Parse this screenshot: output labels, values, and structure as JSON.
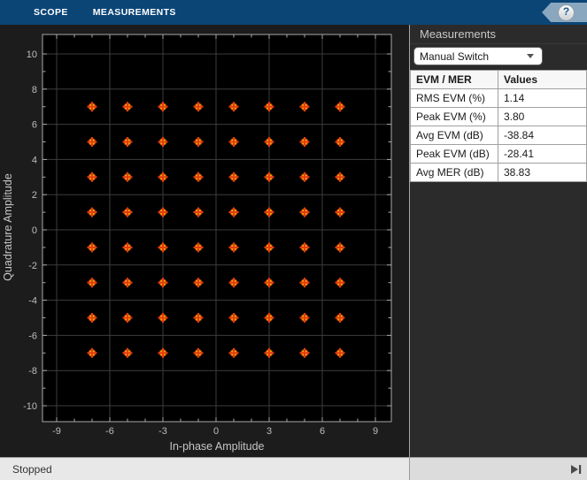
{
  "toolbar": {
    "tabs": [
      {
        "label": "SCOPE"
      },
      {
        "label": "MEASUREMENTS"
      }
    ],
    "help_label": "?"
  },
  "chart_data": {
    "type": "scatter",
    "title": "",
    "xlabel": "In-phase Amplitude",
    "ylabel": "Quadrature Amplitude",
    "xlim": [
      -9.8,
      9.9
    ],
    "ylim": [
      -10.9,
      11.1
    ],
    "xticks": [
      -9,
      -6,
      -3,
      0,
      3,
      6,
      9
    ],
    "yticks": [
      -10,
      -8,
      -6,
      -4,
      -2,
      0,
      2,
      4,
      6,
      8,
      10
    ],
    "minor_tick_step": 1,
    "grid": true,
    "legend": "none",
    "colors": {
      "axes_background": "#000000",
      "figure_background": "#1C1C1C",
      "grid_color": "#3D3D3D",
      "axis_color": "#A8A8A8",
      "tick_label_color": "#BDBDBD",
      "symbol_blob_color": "#FFC400",
      "reference_marker_color": "#E63A12"
    },
    "series": [
      {
        "name": "received-symbols",
        "marker": "density-blob"
      },
      {
        "name": "reference-constellation",
        "marker": "plus"
      }
    ],
    "points": [
      [
        -7,
        7
      ],
      [
        -5,
        7
      ],
      [
        -3,
        7
      ],
      [
        -1,
        7
      ],
      [
        1,
        7
      ],
      [
        3,
        7
      ],
      [
        5,
        7
      ],
      [
        7,
        7
      ],
      [
        -7,
        5
      ],
      [
        -5,
        5
      ],
      [
        -3,
        5
      ],
      [
        -1,
        5
      ],
      [
        1,
        5
      ],
      [
        3,
        5
      ],
      [
        5,
        5
      ],
      [
        7,
        5
      ],
      [
        -7,
        3
      ],
      [
        -5,
        3
      ],
      [
        -3,
        3
      ],
      [
        -1,
        3
      ],
      [
        1,
        3
      ],
      [
        3,
        3
      ],
      [
        5,
        3
      ],
      [
        7,
        3
      ],
      [
        -7,
        1
      ],
      [
        -5,
        1
      ],
      [
        -3,
        1
      ],
      [
        -1,
        1
      ],
      [
        1,
        1
      ],
      [
        3,
        1
      ],
      [
        5,
        1
      ],
      [
        7,
        1
      ],
      [
        -7,
        -1
      ],
      [
        -5,
        -1
      ],
      [
        -3,
        -1
      ],
      [
        -1,
        -1
      ],
      [
        1,
        -1
      ],
      [
        3,
        -1
      ],
      [
        5,
        -1
      ],
      [
        7,
        -1
      ],
      [
        -7,
        -3
      ],
      [
        -5,
        -3
      ],
      [
        -3,
        -3
      ],
      [
        -1,
        -3
      ],
      [
        1,
        -3
      ],
      [
        3,
        -3
      ],
      [
        5,
        -3
      ],
      [
        7,
        -3
      ],
      [
        -7,
        -5
      ],
      [
        -5,
        -5
      ],
      [
        -3,
        -5
      ],
      [
        -1,
        -5
      ],
      [
        1,
        -5
      ],
      [
        3,
        -5
      ],
      [
        5,
        -5
      ],
      [
        7,
        -5
      ],
      [
        -7,
        -7
      ],
      [
        -5,
        -7
      ],
      [
        -3,
        -7
      ],
      [
        -1,
        -7
      ],
      [
        1,
        -7
      ],
      [
        3,
        -7
      ],
      [
        5,
        -7
      ],
      [
        7,
        -7
      ]
    ]
  },
  "measurements_panel": {
    "title": "Measurements",
    "selector": {
      "value": "Manual Switch"
    },
    "table": {
      "columns": [
        "EVM / MER",
        "Values"
      ],
      "rows": [
        [
          "RMS EVM (%)",
          "1.14"
        ],
        [
          "Peak EVM (%)",
          "3.80"
        ],
        [
          "Avg EVM (dB)",
          "-38.84"
        ],
        [
          "Peak EVM (dB)",
          "-28.41"
        ],
        [
          "Avg MER (dB)",
          "38.83"
        ]
      ]
    }
  },
  "status_bar": {
    "text": "Stopped",
    "skip_icon": "step-forward-icon"
  }
}
